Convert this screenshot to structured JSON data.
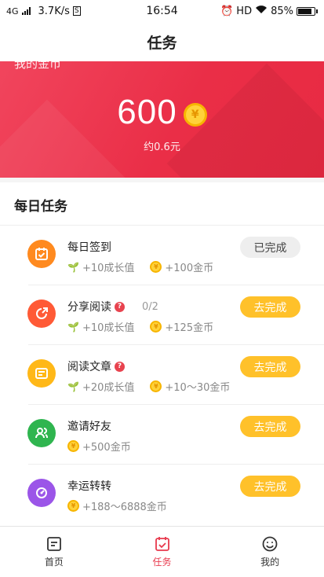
{
  "status_bar": {
    "network": "4G",
    "speed": "3.7K/s",
    "speed_badge": "S",
    "time": "16:54",
    "hd": "HD",
    "battery": "85%",
    "battery_level": 0.85
  },
  "header": {
    "title": "任务"
  },
  "coins": {
    "label": "我的金币",
    "amount": "600",
    "coin_symbol": "¥",
    "approx": "约0.6元"
  },
  "daily": {
    "title": "每日任务",
    "tasks": [
      {
        "name": "每日签到",
        "growth": "+10成长值",
        "coins": "+100金币",
        "button": "已完成",
        "icon": "calendar-check-icon",
        "color": "#ff8a1f"
      },
      {
        "name": "分享阅读",
        "progress": "0/2",
        "growth": "+10成长值",
        "coins": "+125金币",
        "button": "去完成",
        "icon": "share-icon",
        "color": "#ff5a36"
      },
      {
        "name": "阅读文章",
        "growth": "+20成长值",
        "coins": "+10～30金币",
        "button": "去完成",
        "icon": "article-icon",
        "color": "#ffb818"
      },
      {
        "name": "邀请好友",
        "coins": "+500金币",
        "button": "去完成",
        "icon": "invite-friends-icon",
        "color": "#2fb54f"
      },
      {
        "name": "幸运转转",
        "coins": "+188～6888金币",
        "button": "去完成",
        "icon": "lucky-wheel-icon",
        "color": "#9b55e8"
      }
    ]
  },
  "tabbar": {
    "items": [
      {
        "label": "首页"
      },
      {
        "label": "任务"
      },
      {
        "label": "我的"
      }
    ],
    "active_color": "#e8394d"
  }
}
